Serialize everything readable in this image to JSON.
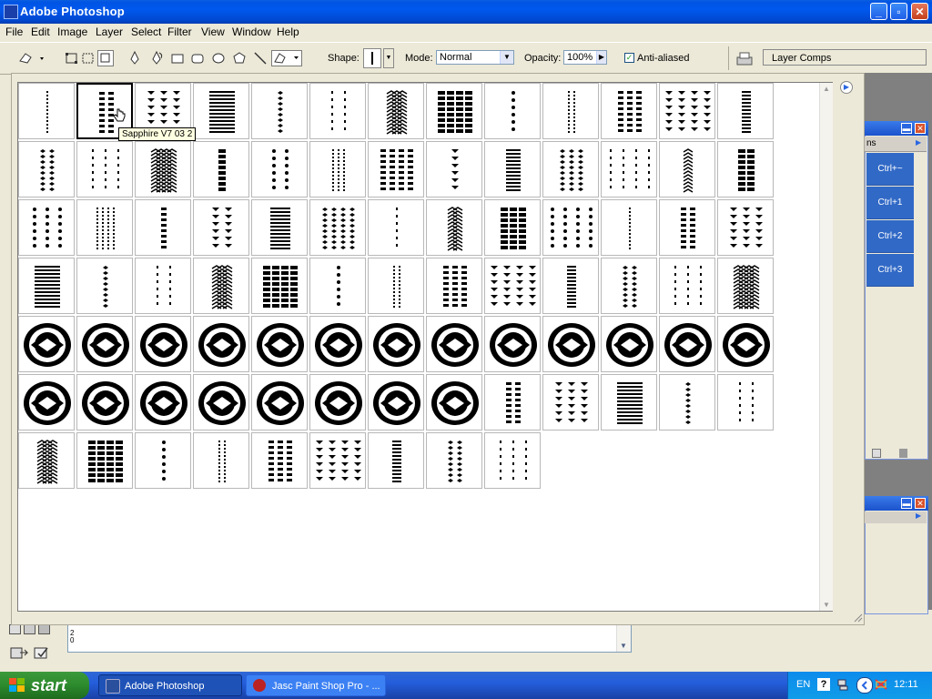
{
  "window": {
    "title": "Adobe Photoshop",
    "minimize": "_",
    "maximize": "▫",
    "close": "✕"
  },
  "menu": [
    "File",
    "Edit",
    "Image",
    "Layer",
    "Select",
    "Filter",
    "View",
    "Window",
    "Help"
  ],
  "options": {
    "shape_label": "Shape:",
    "mode_label": "Mode:",
    "mode_value": "Normal",
    "opacity_label": "Opacity:",
    "opacity_value": "100%",
    "antialiased_label": "Anti-aliased",
    "antialiased_checked": true,
    "layer_comps_tab": "Layer Comps"
  },
  "shape_picker": {
    "tooltip": "Sapphire V7 03 2",
    "selected_index": 1,
    "shape_count": 87,
    "columns": 13
  },
  "panels": {
    "actions_shortcuts": [
      "Ctrl+~",
      "Ctrl+1",
      "Ctrl+2",
      "Ctrl+3"
    ],
    "tab_fragment": "ns"
  },
  "bottom_input": {
    "ruler_text": "2 0"
  },
  "taskbar": {
    "start": "start",
    "tasks": [
      "Adobe Photoshop",
      "Jasc Paint Shop Pro - ..."
    ],
    "language": "EN",
    "help": "?",
    "clock": "12:11"
  },
  "colors": {
    "titlebar": "#0054e3",
    "chrome": "#ece9d8",
    "panel_button": "#3169c6",
    "start_green": "#2d8a2d",
    "tooltip_bg": "#ffffe1"
  }
}
